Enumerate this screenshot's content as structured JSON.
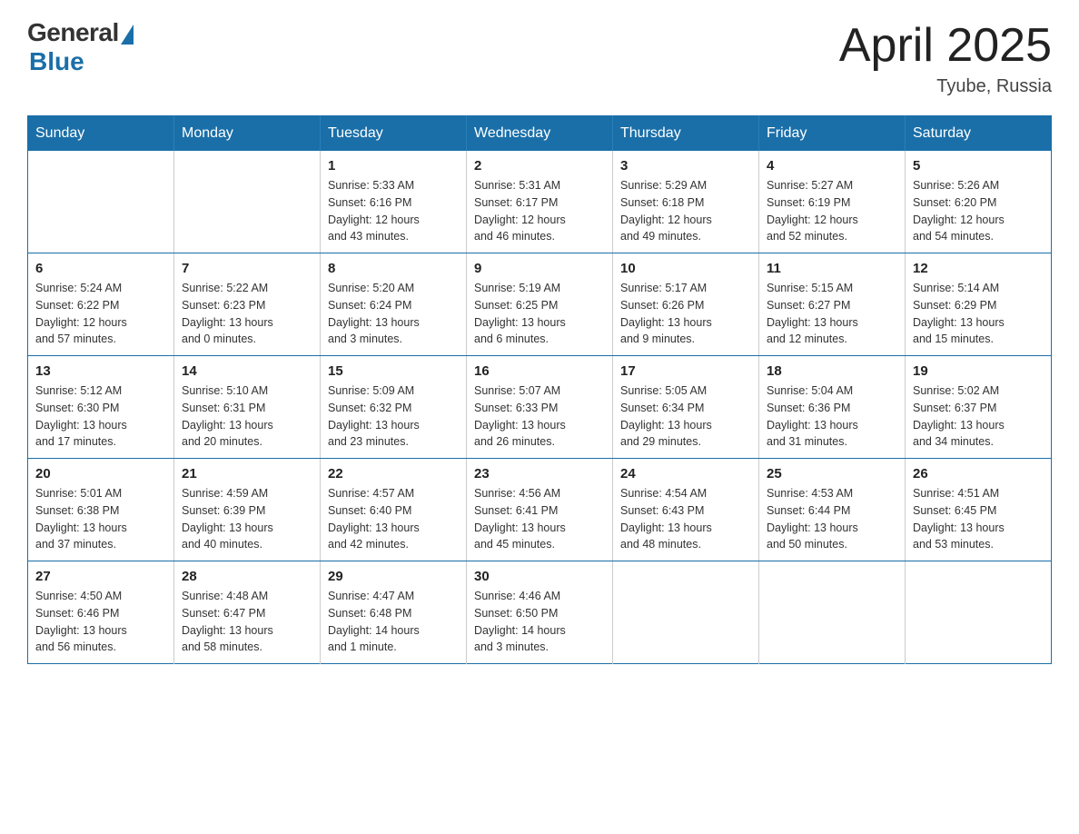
{
  "logo": {
    "general": "General",
    "blue": "Blue",
    "triangle": "▲"
  },
  "title": {
    "month_year": "April 2025",
    "location": "Tyube, Russia"
  },
  "header_days": [
    "Sunday",
    "Monday",
    "Tuesday",
    "Wednesday",
    "Thursday",
    "Friday",
    "Saturday"
  ],
  "weeks": [
    [
      {
        "day": "",
        "info": ""
      },
      {
        "day": "",
        "info": ""
      },
      {
        "day": "1",
        "info": "Sunrise: 5:33 AM\nSunset: 6:16 PM\nDaylight: 12 hours\nand 43 minutes."
      },
      {
        "day": "2",
        "info": "Sunrise: 5:31 AM\nSunset: 6:17 PM\nDaylight: 12 hours\nand 46 minutes."
      },
      {
        "day": "3",
        "info": "Sunrise: 5:29 AM\nSunset: 6:18 PM\nDaylight: 12 hours\nand 49 minutes."
      },
      {
        "day": "4",
        "info": "Sunrise: 5:27 AM\nSunset: 6:19 PM\nDaylight: 12 hours\nand 52 minutes."
      },
      {
        "day": "5",
        "info": "Sunrise: 5:26 AM\nSunset: 6:20 PM\nDaylight: 12 hours\nand 54 minutes."
      }
    ],
    [
      {
        "day": "6",
        "info": "Sunrise: 5:24 AM\nSunset: 6:22 PM\nDaylight: 12 hours\nand 57 minutes."
      },
      {
        "day": "7",
        "info": "Sunrise: 5:22 AM\nSunset: 6:23 PM\nDaylight: 13 hours\nand 0 minutes."
      },
      {
        "day": "8",
        "info": "Sunrise: 5:20 AM\nSunset: 6:24 PM\nDaylight: 13 hours\nand 3 minutes."
      },
      {
        "day": "9",
        "info": "Sunrise: 5:19 AM\nSunset: 6:25 PM\nDaylight: 13 hours\nand 6 minutes."
      },
      {
        "day": "10",
        "info": "Sunrise: 5:17 AM\nSunset: 6:26 PM\nDaylight: 13 hours\nand 9 minutes."
      },
      {
        "day": "11",
        "info": "Sunrise: 5:15 AM\nSunset: 6:27 PM\nDaylight: 13 hours\nand 12 minutes."
      },
      {
        "day": "12",
        "info": "Sunrise: 5:14 AM\nSunset: 6:29 PM\nDaylight: 13 hours\nand 15 minutes."
      }
    ],
    [
      {
        "day": "13",
        "info": "Sunrise: 5:12 AM\nSunset: 6:30 PM\nDaylight: 13 hours\nand 17 minutes."
      },
      {
        "day": "14",
        "info": "Sunrise: 5:10 AM\nSunset: 6:31 PM\nDaylight: 13 hours\nand 20 minutes."
      },
      {
        "day": "15",
        "info": "Sunrise: 5:09 AM\nSunset: 6:32 PM\nDaylight: 13 hours\nand 23 minutes."
      },
      {
        "day": "16",
        "info": "Sunrise: 5:07 AM\nSunset: 6:33 PM\nDaylight: 13 hours\nand 26 minutes."
      },
      {
        "day": "17",
        "info": "Sunrise: 5:05 AM\nSunset: 6:34 PM\nDaylight: 13 hours\nand 29 minutes."
      },
      {
        "day": "18",
        "info": "Sunrise: 5:04 AM\nSunset: 6:36 PM\nDaylight: 13 hours\nand 31 minutes."
      },
      {
        "day": "19",
        "info": "Sunrise: 5:02 AM\nSunset: 6:37 PM\nDaylight: 13 hours\nand 34 minutes."
      }
    ],
    [
      {
        "day": "20",
        "info": "Sunrise: 5:01 AM\nSunset: 6:38 PM\nDaylight: 13 hours\nand 37 minutes."
      },
      {
        "day": "21",
        "info": "Sunrise: 4:59 AM\nSunset: 6:39 PM\nDaylight: 13 hours\nand 40 minutes."
      },
      {
        "day": "22",
        "info": "Sunrise: 4:57 AM\nSunset: 6:40 PM\nDaylight: 13 hours\nand 42 minutes."
      },
      {
        "day": "23",
        "info": "Sunrise: 4:56 AM\nSunset: 6:41 PM\nDaylight: 13 hours\nand 45 minutes."
      },
      {
        "day": "24",
        "info": "Sunrise: 4:54 AM\nSunset: 6:43 PM\nDaylight: 13 hours\nand 48 minutes."
      },
      {
        "day": "25",
        "info": "Sunrise: 4:53 AM\nSunset: 6:44 PM\nDaylight: 13 hours\nand 50 minutes."
      },
      {
        "day": "26",
        "info": "Sunrise: 4:51 AM\nSunset: 6:45 PM\nDaylight: 13 hours\nand 53 minutes."
      }
    ],
    [
      {
        "day": "27",
        "info": "Sunrise: 4:50 AM\nSunset: 6:46 PM\nDaylight: 13 hours\nand 56 minutes."
      },
      {
        "day": "28",
        "info": "Sunrise: 4:48 AM\nSunset: 6:47 PM\nDaylight: 13 hours\nand 58 minutes."
      },
      {
        "day": "29",
        "info": "Sunrise: 4:47 AM\nSunset: 6:48 PM\nDaylight: 14 hours\nand 1 minute."
      },
      {
        "day": "30",
        "info": "Sunrise: 4:46 AM\nSunset: 6:50 PM\nDaylight: 14 hours\nand 3 minutes."
      },
      {
        "day": "",
        "info": ""
      },
      {
        "day": "",
        "info": ""
      },
      {
        "day": "",
        "info": ""
      }
    ]
  ]
}
